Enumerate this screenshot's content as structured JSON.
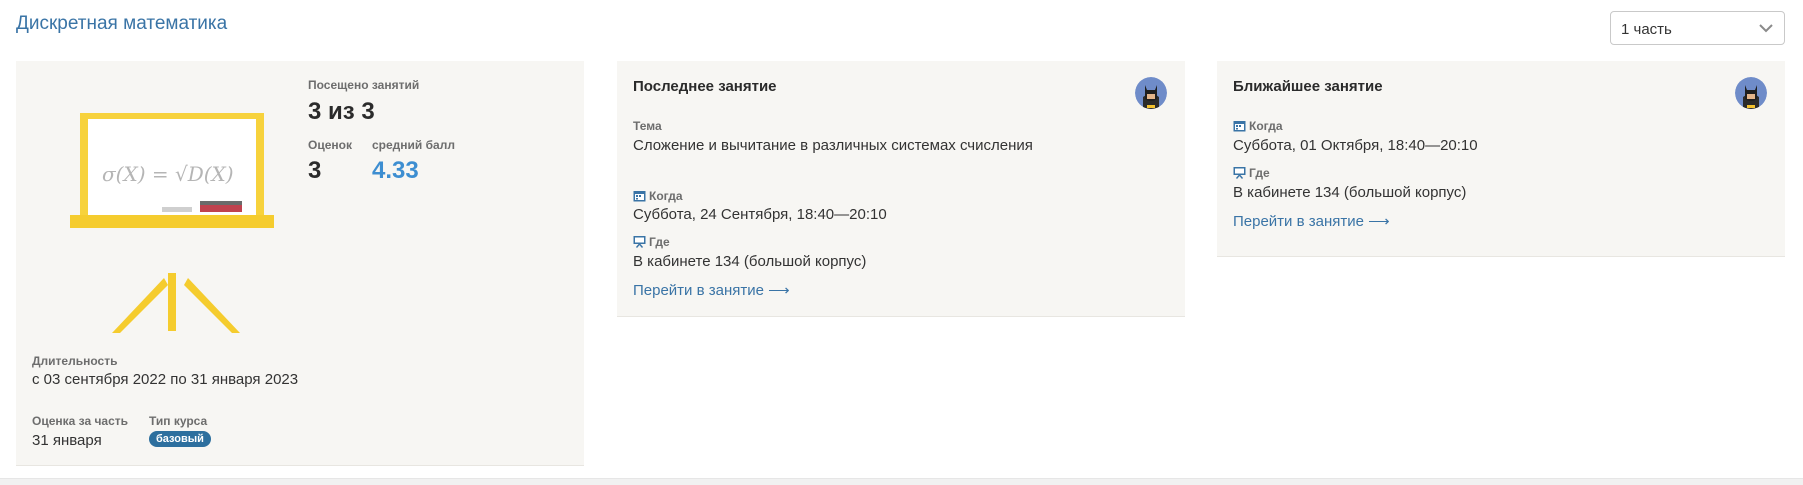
{
  "header": {
    "course_title": "Дискретная математика",
    "part_select_value": "1 часть"
  },
  "stats_card": {
    "board_formula": "σ(X) = √D(X)",
    "attended_label": "Посещено занятий",
    "attended_value": "3 из 3",
    "grades_label": "Оценок",
    "grades_value": "3",
    "avg_label": "средний балл",
    "avg_value": "4.33",
    "duration_label": "Длительность",
    "duration_value": "с 03 сентября 2022 по 31 января 2023",
    "part_grade_label": "Оценка за часть",
    "part_grade_value": "31 января",
    "course_type_label": "Тип курса",
    "course_type_badge": "базовый"
  },
  "last_lesson": {
    "heading": "Последнее занятие",
    "topic_label": "Тема",
    "topic_value": "Сложение и вычитание в различных системах счисления",
    "when_label": "Когда",
    "when_value": "Суббота, 24 Сентября, 18:40—20:10",
    "where_label": "Где",
    "where_value": "В кабинете 134 (большой корпус)",
    "link_label": "Перейти в занятие ⟶"
  },
  "next_lesson": {
    "heading": "Ближайшее занятие",
    "when_label": "Когда",
    "when_value": "Суббота, 01 Октября, 18:40—20:10",
    "where_label": "Где",
    "where_value": "В кабинете 134 (большой корпус)",
    "link_label": "Перейти в занятие ⟶"
  },
  "colors": {
    "accent": "#3a74a6",
    "avg_score": "#3d8ed1",
    "badge": "#2d6f9e",
    "card_bg": "#f7f6f3"
  },
  "icons": [
    "chevron-down-icon",
    "whiteboard-illustration",
    "avatar-icon",
    "calendar-icon",
    "presentation-icon"
  ]
}
